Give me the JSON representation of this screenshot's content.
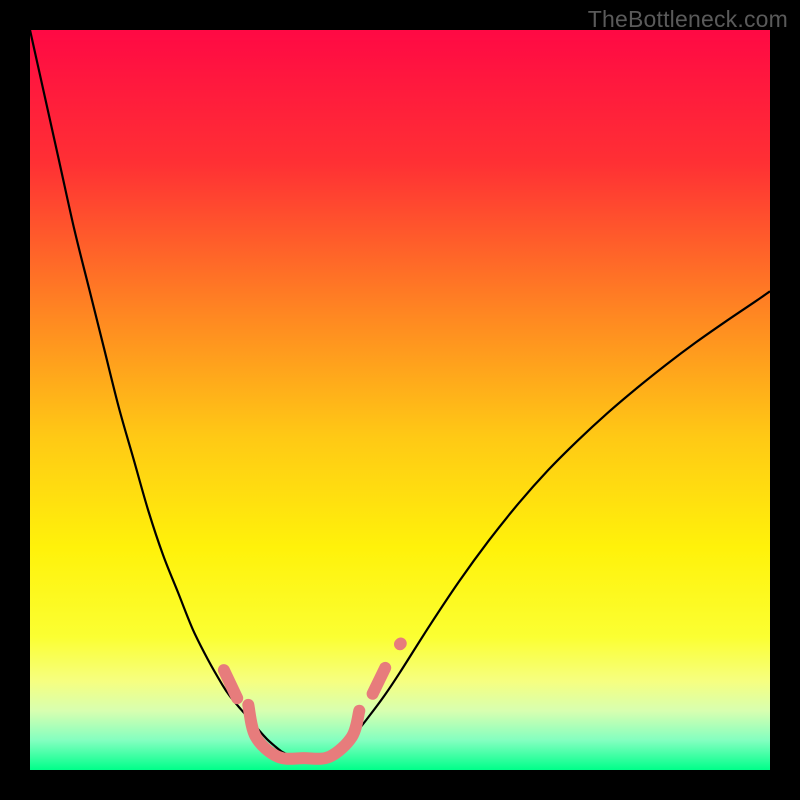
{
  "watermark": {
    "text": "TheBottleneck.com"
  },
  "chart_data": {
    "type": "line",
    "title": "",
    "xlabel": "",
    "ylabel": "",
    "xlim": [
      0,
      100
    ],
    "ylim": [
      0,
      100
    ],
    "grid": false,
    "background": {
      "type": "vertical-gradient",
      "stops": [
        {
          "offset": 0.0,
          "color": "#ff0944"
        },
        {
          "offset": 0.18,
          "color": "#ff3034"
        },
        {
          "offset": 0.38,
          "color": "#ff8522"
        },
        {
          "offset": 0.55,
          "color": "#ffc915"
        },
        {
          "offset": 0.7,
          "color": "#fff20a"
        },
        {
          "offset": 0.82,
          "color": "#fbff32"
        },
        {
          "offset": 0.88,
          "color": "#f6ff80"
        },
        {
          "offset": 0.92,
          "color": "#d8ffb0"
        },
        {
          "offset": 0.96,
          "color": "#83ffc0"
        },
        {
          "offset": 1.0,
          "color": "#00ff8a"
        }
      ]
    },
    "series": [
      {
        "name": "left-curve",
        "stroke": "#000000",
        "stroke_width": 2.2,
        "x": [
          0,
          2,
          4,
          6,
          8,
          10,
          12,
          14,
          16,
          18,
          20,
          22,
          24,
          26,
          27,
          28.5,
          30,
          31,
          32,
          33,
          34,
          35
        ],
        "y": [
          100,
          91,
          82,
          73,
          65,
          57,
          49,
          42,
          35,
          29,
          24,
          19,
          15,
          11.5,
          10,
          8.2,
          6.5,
          5.3,
          4.2,
          3.3,
          2.5,
          2.0
        ]
      },
      {
        "name": "right-curve",
        "stroke": "#000000",
        "stroke_width": 2.2,
        "x": [
          40,
          42,
          44,
          46,
          48,
          50,
          54,
          58,
          62,
          66,
          70,
          74,
          78,
          82,
          86,
          90,
          94,
          98,
          100
        ],
        "y": [
          2.0,
          3.2,
          5.0,
          7.5,
          10.2,
          13.2,
          19.5,
          25.5,
          31.0,
          36.0,
          40.5,
          44.5,
          48.2,
          51.6,
          54.8,
          57.8,
          60.6,
          63.3,
          64.7
        ]
      },
      {
        "name": "bottom-flat-curve",
        "stroke": "#e77c7c",
        "stroke_width": 12,
        "linecap": "round",
        "x": [
          29.5,
          30.5,
          33.5,
          37,
          40.5,
          43.5,
          44.5
        ],
        "y": [
          8.8,
          4.5,
          1.8,
          1.6,
          1.8,
          4.5,
          8.0
        ]
      },
      {
        "name": "left-short-segment",
        "stroke": "#e77c7c",
        "stroke_width": 12,
        "linecap": "round",
        "x": [
          26.2,
          28.0
        ],
        "y": [
          13.5,
          9.7
        ]
      },
      {
        "name": "right-short-segment",
        "stroke": "#e77c7c",
        "stroke_width": 12,
        "linecap": "round",
        "x": [
          46.3,
          48.0
        ],
        "y": [
          10.3,
          13.8
        ]
      },
      {
        "name": "right-dot",
        "stroke": "#e77c7c",
        "stroke_width": 12,
        "linecap": "round",
        "x": [
          50.0,
          50.1
        ],
        "y": [
          17.0,
          17.1
        ]
      }
    ]
  }
}
